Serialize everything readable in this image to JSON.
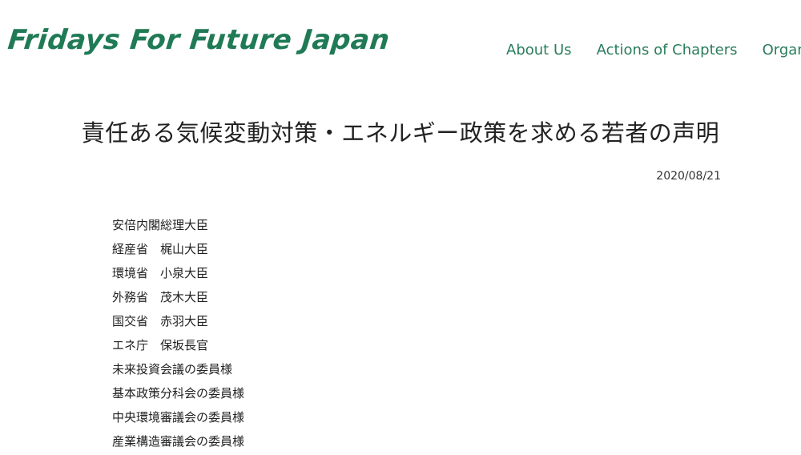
{
  "header": {
    "logo_text": "Fridays For Future Japan",
    "nav": [
      {
        "label": "About Us"
      },
      {
        "label": "Actions of Chapters"
      },
      {
        "label": "Organize"
      }
    ]
  },
  "article": {
    "title": "責任ある気候変動対策・エネルギー政策を求める若者の声明",
    "date": "2020/08/21",
    "addressees": [
      "安倍内閣総理大臣",
      "経産省　梶山大臣",
      "環境省　小泉大臣",
      "外務省　茂木大臣",
      "国交省　赤羽大臣",
      "エネ庁　保坂長官",
      "未来投資会議の委員様",
      "基本政策分科会の委員様",
      "中央環境審議会の委員様",
      "産業構造審議会の委員様"
    ]
  },
  "colors": {
    "brand_green": "#1f7a55",
    "nav_green": "#2a7d5c",
    "text": "#222222"
  }
}
